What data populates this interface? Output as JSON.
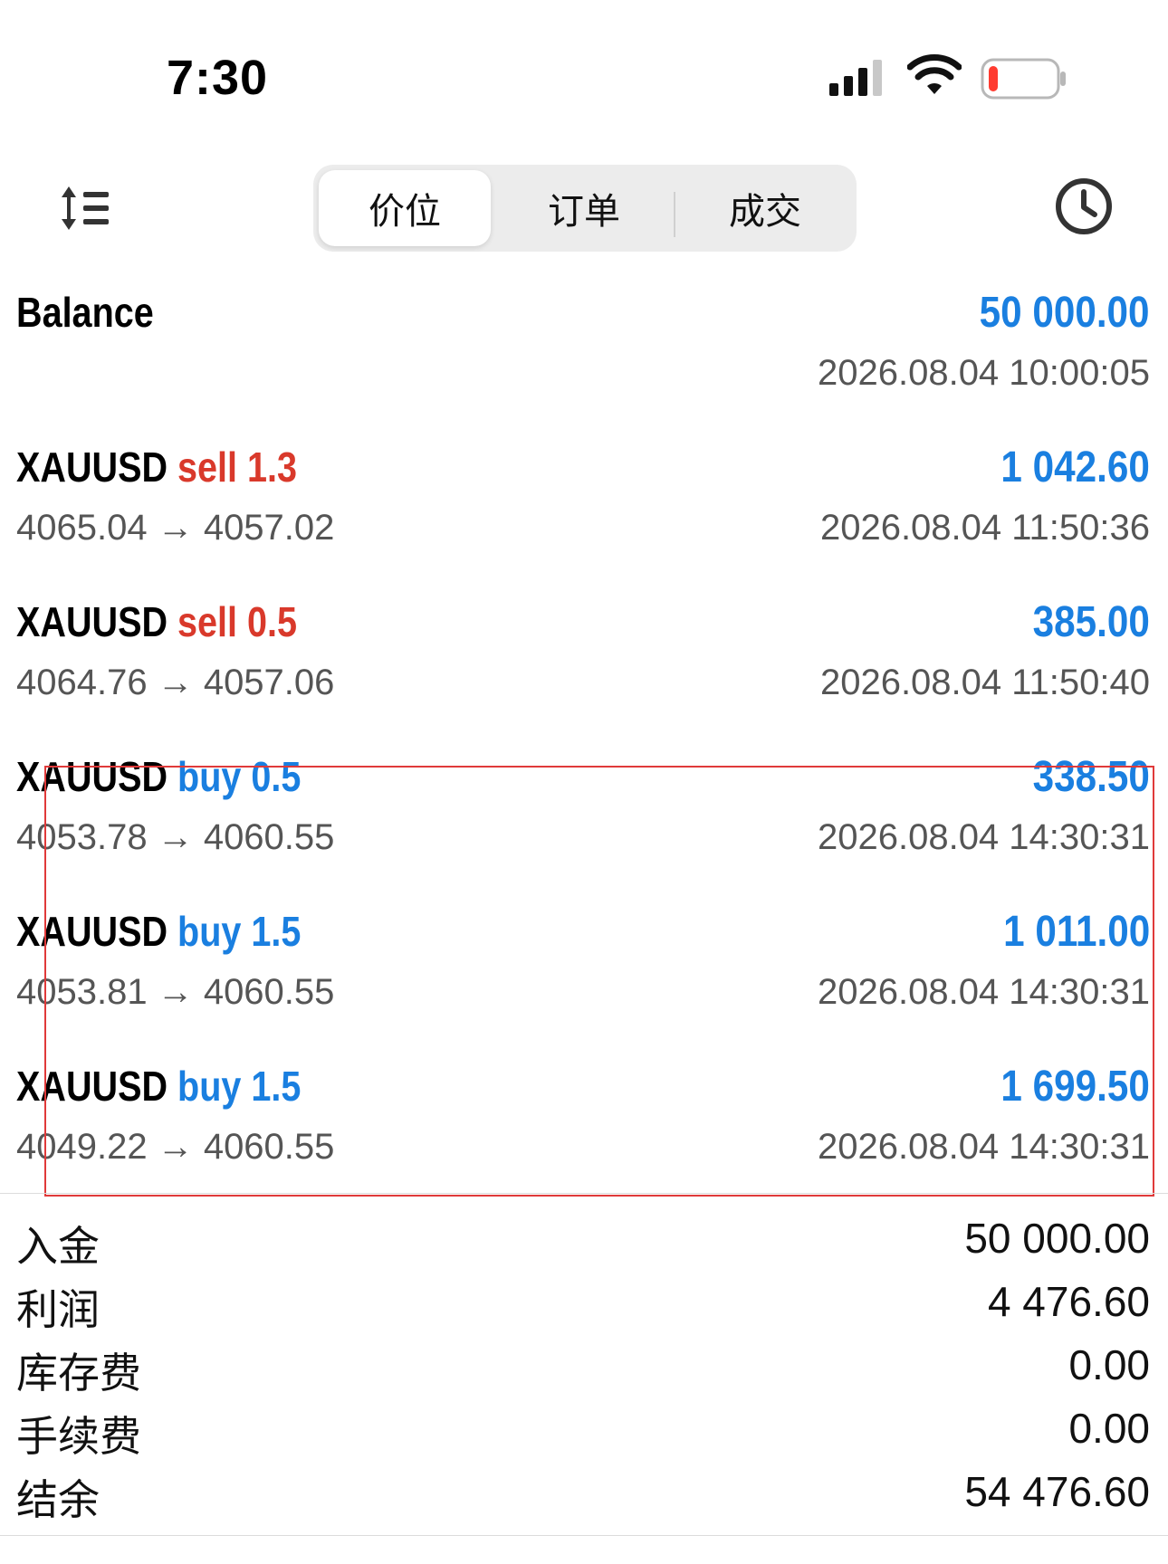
{
  "status_bar": {
    "time": "7:30"
  },
  "toolbar": {
    "tabs": [
      {
        "label": "价位",
        "active": true
      },
      {
        "label": "订单",
        "active": false
      },
      {
        "label": "成交",
        "active": false
      }
    ]
  },
  "balance": {
    "label": "Balance",
    "amount": "50 000.00",
    "time": "2026.08.04 10:00:05"
  },
  "deals": [
    {
      "symbol": "XAUUSD",
      "side": "sell",
      "volume": "1.3",
      "prices": "4065.04 → 4057.02",
      "profit": "1 042.60",
      "time": "2026.08.04 11:50:36"
    },
    {
      "symbol": "XAUUSD",
      "side": "sell",
      "volume": "0.5",
      "prices": "4064.76 → 4057.06",
      "profit": "385.00",
      "time": "2026.08.04 11:50:40"
    },
    {
      "symbol": "XAUUSD",
      "side": "buy",
      "volume": "0.5",
      "prices": "4053.78 → 4060.55",
      "profit": "338.50",
      "time": "2026.08.04 14:30:31"
    },
    {
      "symbol": "XAUUSD",
      "side": "buy",
      "volume": "1.5",
      "prices": "4053.81 → 4060.55",
      "profit": "1 011.00",
      "time": "2026.08.04 14:30:31"
    },
    {
      "symbol": "XAUUSD",
      "side": "buy",
      "volume": "1.5",
      "prices": "4049.22 → 4060.55",
      "profit": "1 699.50",
      "time": "2026.08.04 14:30:31"
    }
  ],
  "summary": [
    {
      "label": "入金",
      "value": "50 000.00"
    },
    {
      "label": "利润",
      "value": "4 476.60"
    },
    {
      "label": "库存费",
      "value": "0.00"
    },
    {
      "label": "手续费",
      "value": "0.00"
    },
    {
      "label": "结余",
      "value": "54 476.60"
    }
  ],
  "colors": {
    "sell": "#d9392b",
    "buy": "#1a7fe0",
    "amount": "#1a7fe0",
    "highlight": "#e03a3a"
  }
}
